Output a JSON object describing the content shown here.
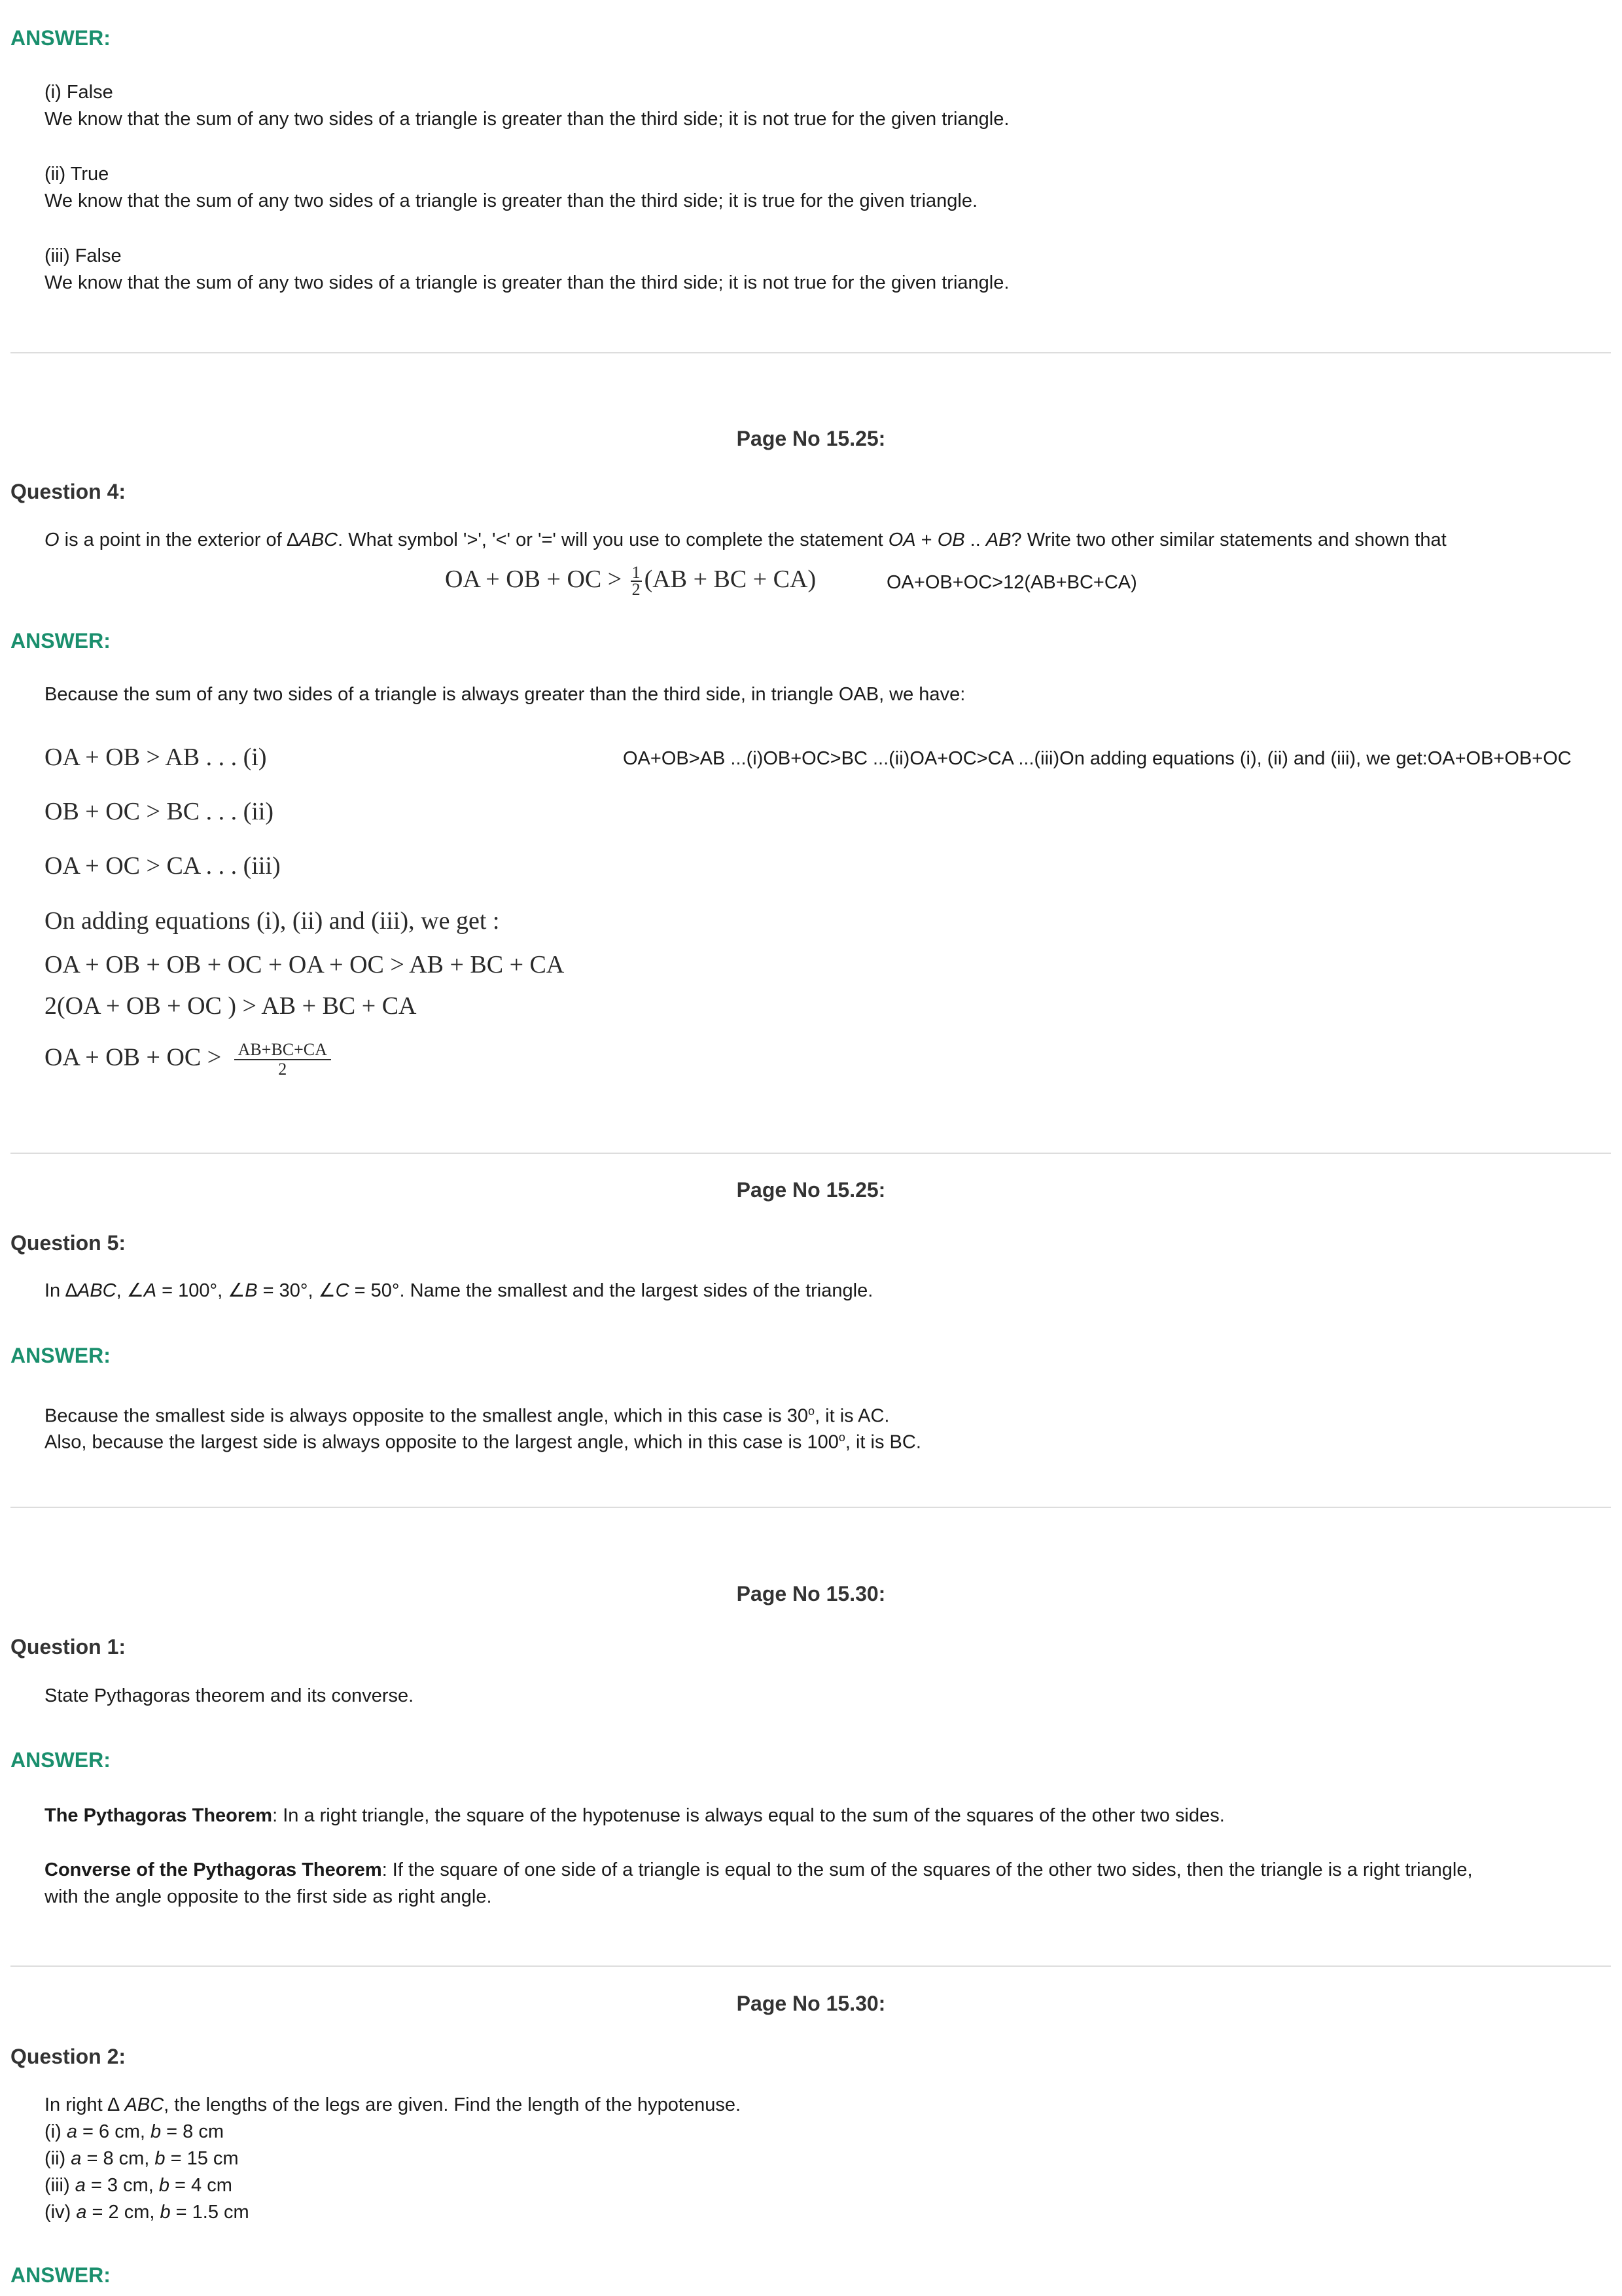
{
  "section_q3_answer": {
    "label": "ANSWER:",
    "items": [
      {
        "verdict": "(i) False",
        "explanation": "We know that the sum of any two sides of a triangle is greater than the third side; it is not true for the given triangle."
      },
      {
        "verdict": "(ii) True",
        "explanation": "We know that the sum of any two sides of a triangle is greater than the third side; it is true for the given triangle."
      },
      {
        "verdict": "(iii) False",
        "explanation": "We know that the sum of any two sides of a triangle is greater than the third side; it is not true for the given triangle."
      }
    ]
  },
  "q4": {
    "page": "Page No 15.25:",
    "title": "Question 4:",
    "text_a": "O",
    "text_b": " is a point in the exterior of ∆",
    "text_c": "ABC",
    "text_d": ". What symbol '>', '<' or '=' will you use to complete the statement ",
    "text_e": "OA",
    "text_f": " + ",
    "text_g": "OB",
    "text_h": " .. ",
    "text_i": "AB",
    "text_j": "? Write two other similar statements and shown that",
    "formula_left": "OA + OB + OC > ",
    "formula_num": "1",
    "formula_den": "2",
    "formula_right": "(AB + BC + CA)",
    "formula_alt": "OA+OB+OC>12(AB+BC+CA)",
    "answer_label": "ANSWER:",
    "intro": "Because the sum of any two sides of a triangle is always greater than the third side, in triangle OAB, we have:",
    "eq1": "OA + OB > AB   . . . (i)",
    "eq2": "OB + OC > BC   . . . (ii)",
    "eq3": "OA + OC > CA   . . . (iii)",
    "eq4": "On  adding  equations (i),  (ii)  and  (iii),  we  get :",
    "eq5": "OA + OB + OB + OC + OA + OC > AB + BC + CA",
    "eq6": "2(OA + OB + OC ) > AB + BC + CA",
    "eq7_left": "OA + OB + OC > ",
    "eq7_num": "AB+BC+CA",
    "eq7_den": "2",
    "alt_text": "OA+OB>AB   ...(i)OB+OC>BC   ...(ii)OA+OC>CA   ...(iii)On adding equations (i), (ii) and (iii), we get:OA+OB+OB+OC"
  },
  "q5": {
    "page": "Page No 15.25:",
    "title": "Question 5:",
    "t1": "In ∆",
    "t2": "ABC",
    "t3": ", ∠",
    "t4": "A",
    "t5": " = 100°, ∠",
    "t6": "B",
    "t7": " = 30°, ∠",
    "t8": "C",
    "t9": " = 50°. Name the smallest and the largest sides of the triangle.",
    "answer_label": "ANSWER:",
    "line1_a": "Because the smallest side is always opposite to the smallest angle, which in this case is 30",
    "line1_sup": "o",
    "line1_b": ", it is AC.",
    "line2_a": "Also, because the largest side is always opposite to the largest angle, which in this case is 100",
    "line2_sup": "o",
    "line2_b": ", it is BC."
  },
  "q1": {
    "page": "Page No 15.30:",
    "title": "Question 1:",
    "text": "State Pythagoras theorem and its converse.",
    "answer_label": "ANSWER:",
    "p1_bold": "The Pythagoras Theorem",
    "p1_rest": ": In a right triangle, the square of the hypotenuse is always equal to the sum of the squares of the other two sides.",
    "p2_bold": "Converse of the Pythagoras Theorem",
    "p2_rest": ": If the square of one side of a triangle is equal to the sum of the squares of the other two sides, then the triangle is a right triangle,",
    "p2_line2": "with the angle opposite to the first side as right angle."
  },
  "q2": {
    "page": "Page No 15.30:",
    "title": "Question 2:",
    "intro_a": "In right ∆ ",
    "intro_b": "ABC",
    "intro_c": ", the lengths of the legs are given. Find the length of the hypotenuse.",
    "items": [
      {
        "n": "(i) ",
        "a": "a",
        "av": " = 6 cm, ",
        "b": "b",
        "bv": " = 8 cm"
      },
      {
        "n": "(ii) ",
        "a": "a",
        "av": " = 8 cm, ",
        "b": "b",
        "bv": " = 15 cm"
      },
      {
        "n": "(iii) ",
        "a": "a",
        "av": " = 3 cm, ",
        "b": "b",
        "bv": " = 4 cm"
      },
      {
        "n": "(iv) ",
        "a": "a",
        "av": " = 2 cm, ",
        "b": "b",
        "bv": " = 1.5 cm"
      }
    ],
    "answer_label": "ANSWER:"
  }
}
